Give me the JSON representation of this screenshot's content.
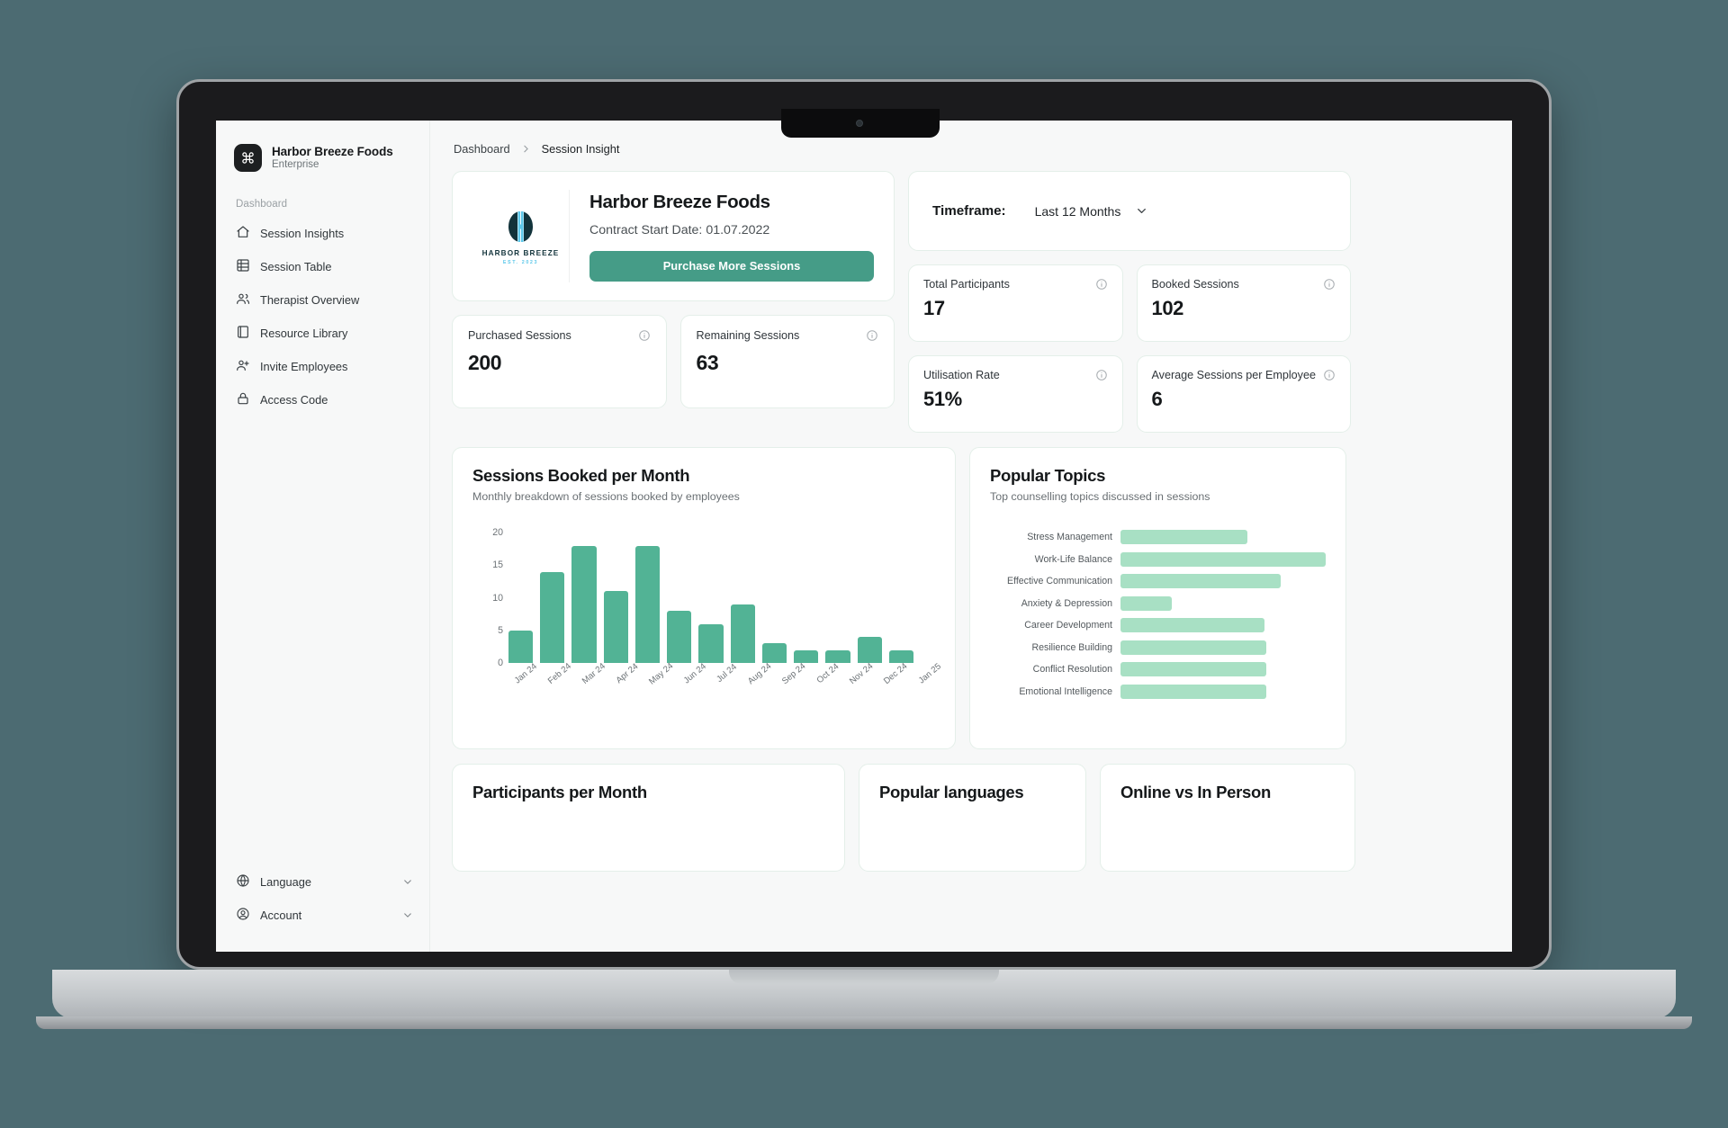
{
  "sidebar": {
    "brand": {
      "name": "Harbor Breeze Foods",
      "plan": "Enterprise",
      "logo_icon": "command-icon"
    },
    "section_label": "Dashboard",
    "items": [
      {
        "label": "Session Insights",
        "icon": "home-icon"
      },
      {
        "label": "Session Table",
        "icon": "table-icon"
      },
      {
        "label": "Therapist Overview",
        "icon": "users-icon"
      },
      {
        "label": "Resource Library",
        "icon": "book-icon"
      },
      {
        "label": "Invite Employees",
        "icon": "user-plus-icon"
      },
      {
        "label": "Access Code",
        "icon": "lock-icon"
      }
    ],
    "bottom_items": [
      {
        "label": "Language",
        "icon": "globe-icon"
      },
      {
        "label": "Account",
        "icon": "user-circle-icon"
      }
    ]
  },
  "breadcrumb": {
    "root": "Dashboard",
    "current": "Session Insight"
  },
  "company": {
    "name": "Harbor Breeze Foods",
    "contract_start": "Contract Start Date: 01.07.2022",
    "cta_label": "Purchase More Sessions",
    "logo_wordmark": "HARBOR BREEZE",
    "logo_est": "EST. 2023"
  },
  "timeframe": {
    "label": "Timeframe:",
    "value": "Last 12 Months"
  },
  "stats_left": [
    {
      "label": "Purchased Sessions",
      "value": "200"
    },
    {
      "label": "Remaining Sessions",
      "value": "63"
    }
  ],
  "stats_right": [
    {
      "label": "Total Participants",
      "value": "17"
    },
    {
      "label": "Booked Sessions",
      "value": "102"
    },
    {
      "label": "Utilisation Rate",
      "value": "51%"
    },
    {
      "label": "Average Sessions per Employee",
      "value": "6"
    }
  ],
  "bottom_cards": [
    {
      "title": "Participants per Month"
    },
    {
      "title": "Popular languages"
    },
    {
      "title": "Online vs In Person"
    }
  ],
  "colors": {
    "accent": "#459c87",
    "bar_green": "#52b395",
    "topic_green": "#a8e0c4",
    "page_bg": "#f7f8f8",
    "card_border": "#e4efe9"
  },
  "chart_data": [
    {
      "type": "bar",
      "title": "Sessions Booked per Month",
      "subtitle": "Monthly breakdown of sessions booked by employees",
      "xlabel": "",
      "ylabel": "",
      "ylim": [
        0,
        21
      ],
      "yticks": [
        0,
        5,
        10,
        15,
        20
      ],
      "grid": false,
      "categories": [
        "Jan 24",
        "Feb 24",
        "Mar 24",
        "Apr 24",
        "May 24",
        "Jun 24",
        "Jul 24",
        "Aug 24",
        "Sep 24",
        "Oct 24",
        "Nov 24",
        "Dec 24",
        "Jan 25"
      ],
      "values": [
        5,
        14,
        18,
        11,
        18,
        8,
        6,
        9,
        3,
        2,
        2,
        4,
        2
      ]
    },
    {
      "type": "bar",
      "orientation": "horizontal",
      "title": "Popular Topics",
      "subtitle": "Top counselling topics discussed in sessions",
      "xlabel": "",
      "ylabel": "",
      "xlim": [
        0,
        100
      ],
      "grid": false,
      "categories": [
        "Stress Management",
        "Work-Life Balance",
        "Effective Communication",
        "Anxiety & Depression",
        "Career Development",
        "Resilience Building",
        "Conflict Resolution",
        "Emotional Intelligence"
      ],
      "values": [
        62,
        100,
        78,
        25,
        70,
        71,
        71,
        71
      ]
    }
  ]
}
